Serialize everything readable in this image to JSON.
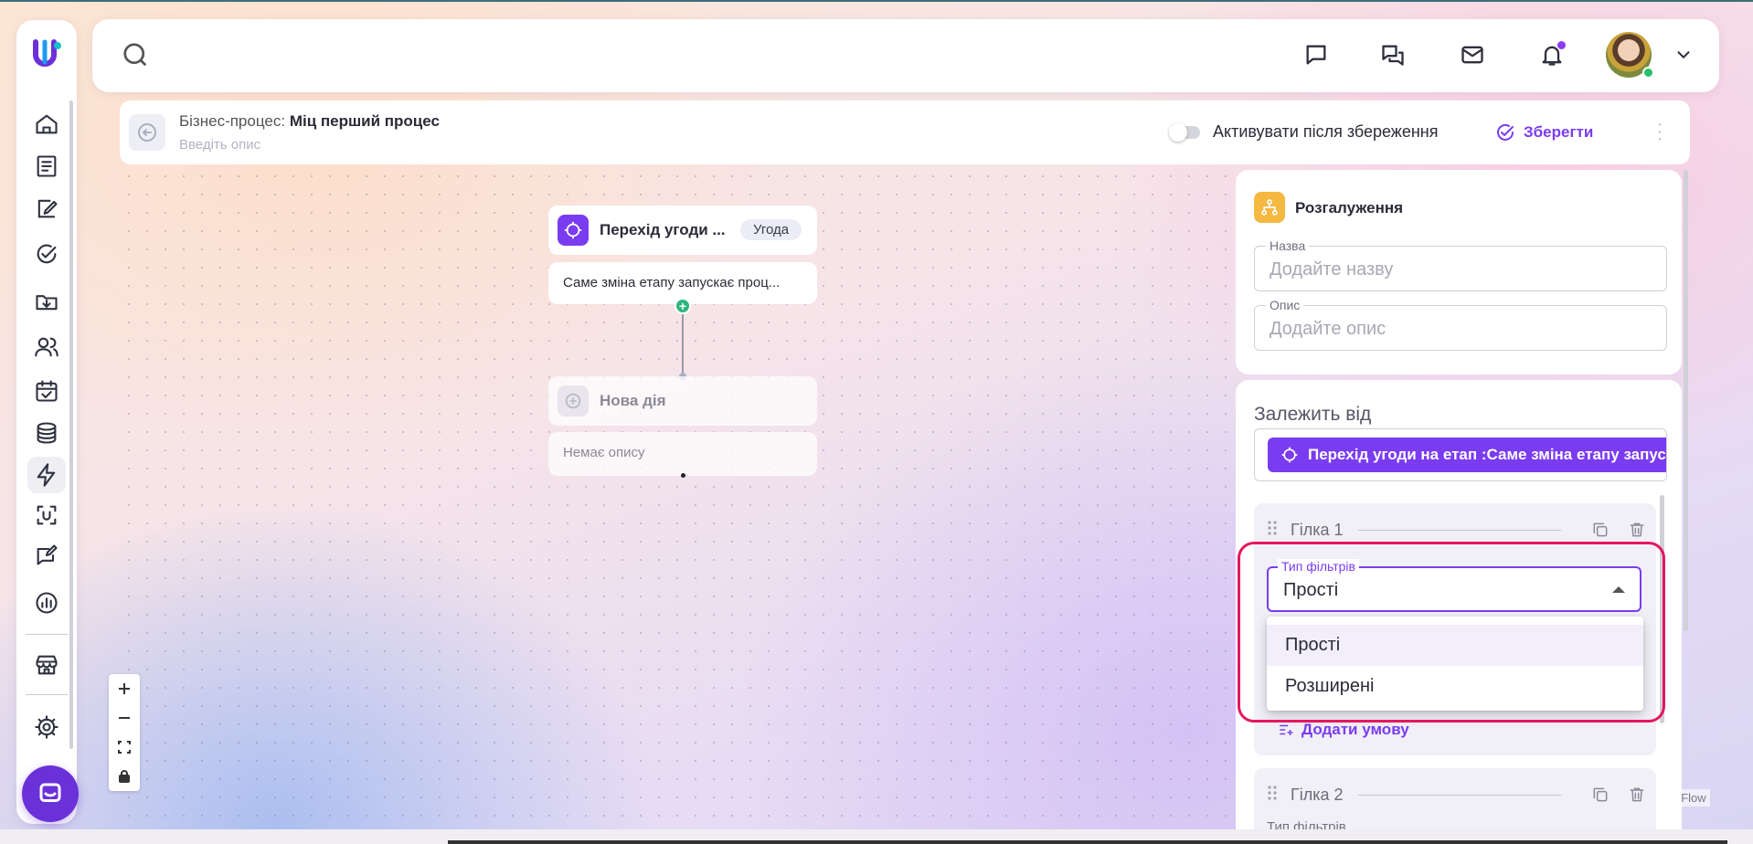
{
  "header": {
    "icons": [
      "search-icon",
      "chat-icon",
      "messages-icon",
      "mail-icon",
      "bell-icon",
      "avatar",
      "chevron-down-icon"
    ]
  },
  "sidebar": {
    "items": [
      "home-icon",
      "ledger-icon",
      "contract-icon",
      "tasks-check-icon",
      "inbox-download-icon",
      "contacts-icon",
      "calendar-check-icon",
      "database-stack-icon",
      "automation-bolt-icon",
      "scan-icon",
      "feedback-icon",
      "analytics-icon",
      "store-icon",
      "settings-gear-icon"
    ],
    "active": "automation-bolt-icon"
  },
  "process": {
    "label": "Бізнес-процес:",
    "name": "Міц перший процес",
    "description_placeholder": "Введіть опис",
    "activate_label": "Активувати після збереження",
    "activate_on": false,
    "save_label": "Зберегти"
  },
  "canvas": {
    "trigger": {
      "title": "Перехід угоди ...",
      "badge": "Угода",
      "text": "Саме зміна етапу запускає проц..."
    },
    "new_action": {
      "title": "Нова дія",
      "text": "Немає опису"
    },
    "attribution": "t Flow"
  },
  "panel": {
    "title": "Розгалуження",
    "name_label": "Назва",
    "name_placeholder": "Додайте назву",
    "desc_label": "Опис",
    "desc_placeholder": "Додайте опис",
    "depends_label": "Залежить від",
    "depends_chip": "Перехід угоди на етап :Саме зміна етапу запускає процес",
    "branches": [
      {
        "title": "Гілка 1",
        "add_condition": "Додати умову"
      },
      {
        "title": "Гілка 2",
        "filter_label": "Тип фільтрів"
      }
    ],
    "filter_select": {
      "label": "Тип фільтрів",
      "value": "Прості",
      "options": [
        "Прості",
        "Розширені"
      ],
      "highlighted": 0
    }
  },
  "colors": {
    "accent": "#7a3cf0",
    "highlight": "#e5175f",
    "online": "#26c06a",
    "branch_icon": "#f5b840"
  }
}
